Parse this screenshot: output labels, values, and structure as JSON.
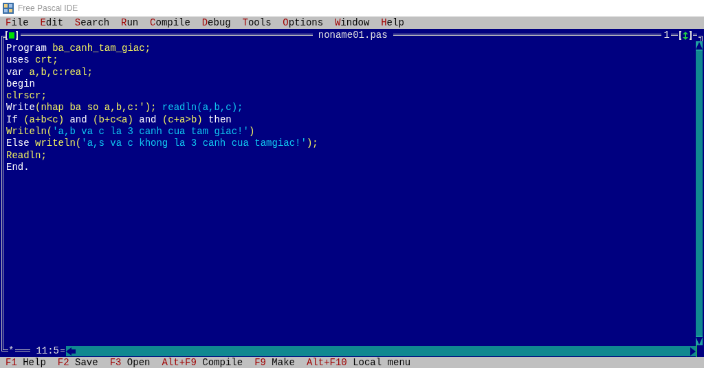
{
  "window": {
    "title": "Free Pascal IDE"
  },
  "menu": [
    {
      "label": "File"
    },
    {
      "label": "Edit"
    },
    {
      "label": "Search"
    },
    {
      "label": "Run"
    },
    {
      "label": "Compile"
    },
    {
      "label": "Debug"
    },
    {
      "label": "Tools"
    },
    {
      "label": "Options"
    },
    {
      "label": "Window"
    },
    {
      "label": "Help"
    }
  ],
  "editor": {
    "title": "noname01.pas",
    "window_number": "1",
    "modified_mark": "*",
    "cursor_position": "11:5",
    "lines": [
      {
        "segments": [
          {
            "kind": "reserved",
            "text": "Program "
          },
          {
            "kind": "ident",
            "text": "ba_canh_tam_giac;"
          }
        ]
      },
      {
        "segments": [
          {
            "kind": "reserved",
            "text": "uses "
          },
          {
            "kind": "ident",
            "text": "crt;"
          }
        ]
      },
      {
        "segments": [
          {
            "kind": "reserved",
            "text": "var "
          },
          {
            "kind": "ident",
            "text": "a,b,c:real;"
          }
        ]
      },
      {
        "segments": [
          {
            "kind": "reserved",
            "text": "begin"
          }
        ]
      },
      {
        "segments": [
          {
            "kind": "ident",
            "text": "clrscr;"
          }
        ]
      },
      {
        "segments": [
          {
            "kind": "reserved",
            "text": "Write"
          },
          {
            "kind": "ident",
            "text": "(nhap ba so a,b,c:'); "
          },
          {
            "kind": "string",
            "text": "readln(a,b,c);"
          }
        ]
      },
      {
        "segments": [
          {
            "kind": "reserved",
            "text": "If "
          },
          {
            "kind": "ident",
            "text": "(a+b<c)"
          },
          {
            "kind": "reserved",
            "text": " and "
          },
          {
            "kind": "ident",
            "text": "(b+c<a)"
          },
          {
            "kind": "reserved",
            "text": " and "
          },
          {
            "kind": "ident",
            "text": "(c+a>b)"
          },
          {
            "kind": "reserved",
            "text": " then"
          }
        ]
      },
      {
        "segments": [
          {
            "kind": "ident",
            "text": "Writeln("
          },
          {
            "kind": "string",
            "text": "'a,b va c la 3 canh cua tam giac!'"
          },
          {
            "kind": "ident",
            "text": ")"
          }
        ]
      },
      {
        "segments": [
          {
            "kind": "reserved",
            "text": "Else "
          },
          {
            "kind": "ident",
            "text": "writeln("
          },
          {
            "kind": "string",
            "text": "'a,s va c khong la 3 canh cua tamgiac!'"
          },
          {
            "kind": "ident",
            "text": ");"
          }
        ]
      },
      {
        "segments": [
          {
            "kind": "ident",
            "text": "Readln;"
          }
        ]
      },
      {
        "segments": [
          {
            "kind": "reserved",
            "text": "End."
          }
        ]
      }
    ]
  },
  "status_bar": [
    {
      "key": "F1",
      "action": "Help"
    },
    {
      "key": "F2",
      "action": "Save"
    },
    {
      "key": "F3",
      "action": "Open"
    },
    {
      "key": "Alt+F9",
      "action": "Compile"
    },
    {
      "key": "F9",
      "action": "Make"
    },
    {
      "key": "Alt+F10",
      "action": "Local menu"
    }
  ]
}
